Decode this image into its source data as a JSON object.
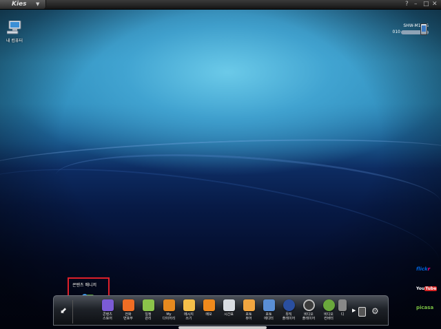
{
  "app": {
    "name": "Kies"
  },
  "window_controls": {
    "help": "?",
    "minimize": "–",
    "maximize": "□",
    "close": "✕"
  },
  "desktop": {
    "my_computer_label": "내 컴퓨터"
  },
  "device": {
    "model": "SHW-M110S",
    "id_prefix": "010"
  },
  "tooltip": {
    "label": "콘텐츠 매니저"
  },
  "dock": {
    "items": [
      {
        "label": "콘텐츠\n스토어",
        "color": "#7b5bd6"
      },
      {
        "label": "전화\n번호부",
        "color": "#f06d24"
      },
      {
        "label": "일정\n관리",
        "color": "#8bc34a"
      },
      {
        "label": "My\n다이어리",
        "color": "#e68a1f"
      },
      {
        "label": "메시지\n쓰기",
        "color": "#f5c04a"
      },
      {
        "label": "메모",
        "color": "#f08a1c"
      },
      {
        "label": "시간표",
        "color": "#d9dde3"
      },
      {
        "label": "포토\n뷰어",
        "color": "#f2a640"
      },
      {
        "label": "포토\n에디터",
        "color": "#5a8fd6"
      },
      {
        "label": "뮤직\n플레이어",
        "color": "#2a4fa0"
      },
      {
        "label": "비디오\n플레이어",
        "color": "#3c3c3c"
      },
      {
        "label": "비디오\n컨버터",
        "color": "#6aa83c"
      },
      {
        "label": "디",
        "color": "#888888"
      }
    ],
    "more_arrow": "▶"
  },
  "services": {
    "flickr_a": "flick",
    "flickr_b": "r",
    "youtube_you": "You",
    "youtube_tube": "Tube",
    "picasa": "picasa"
  }
}
